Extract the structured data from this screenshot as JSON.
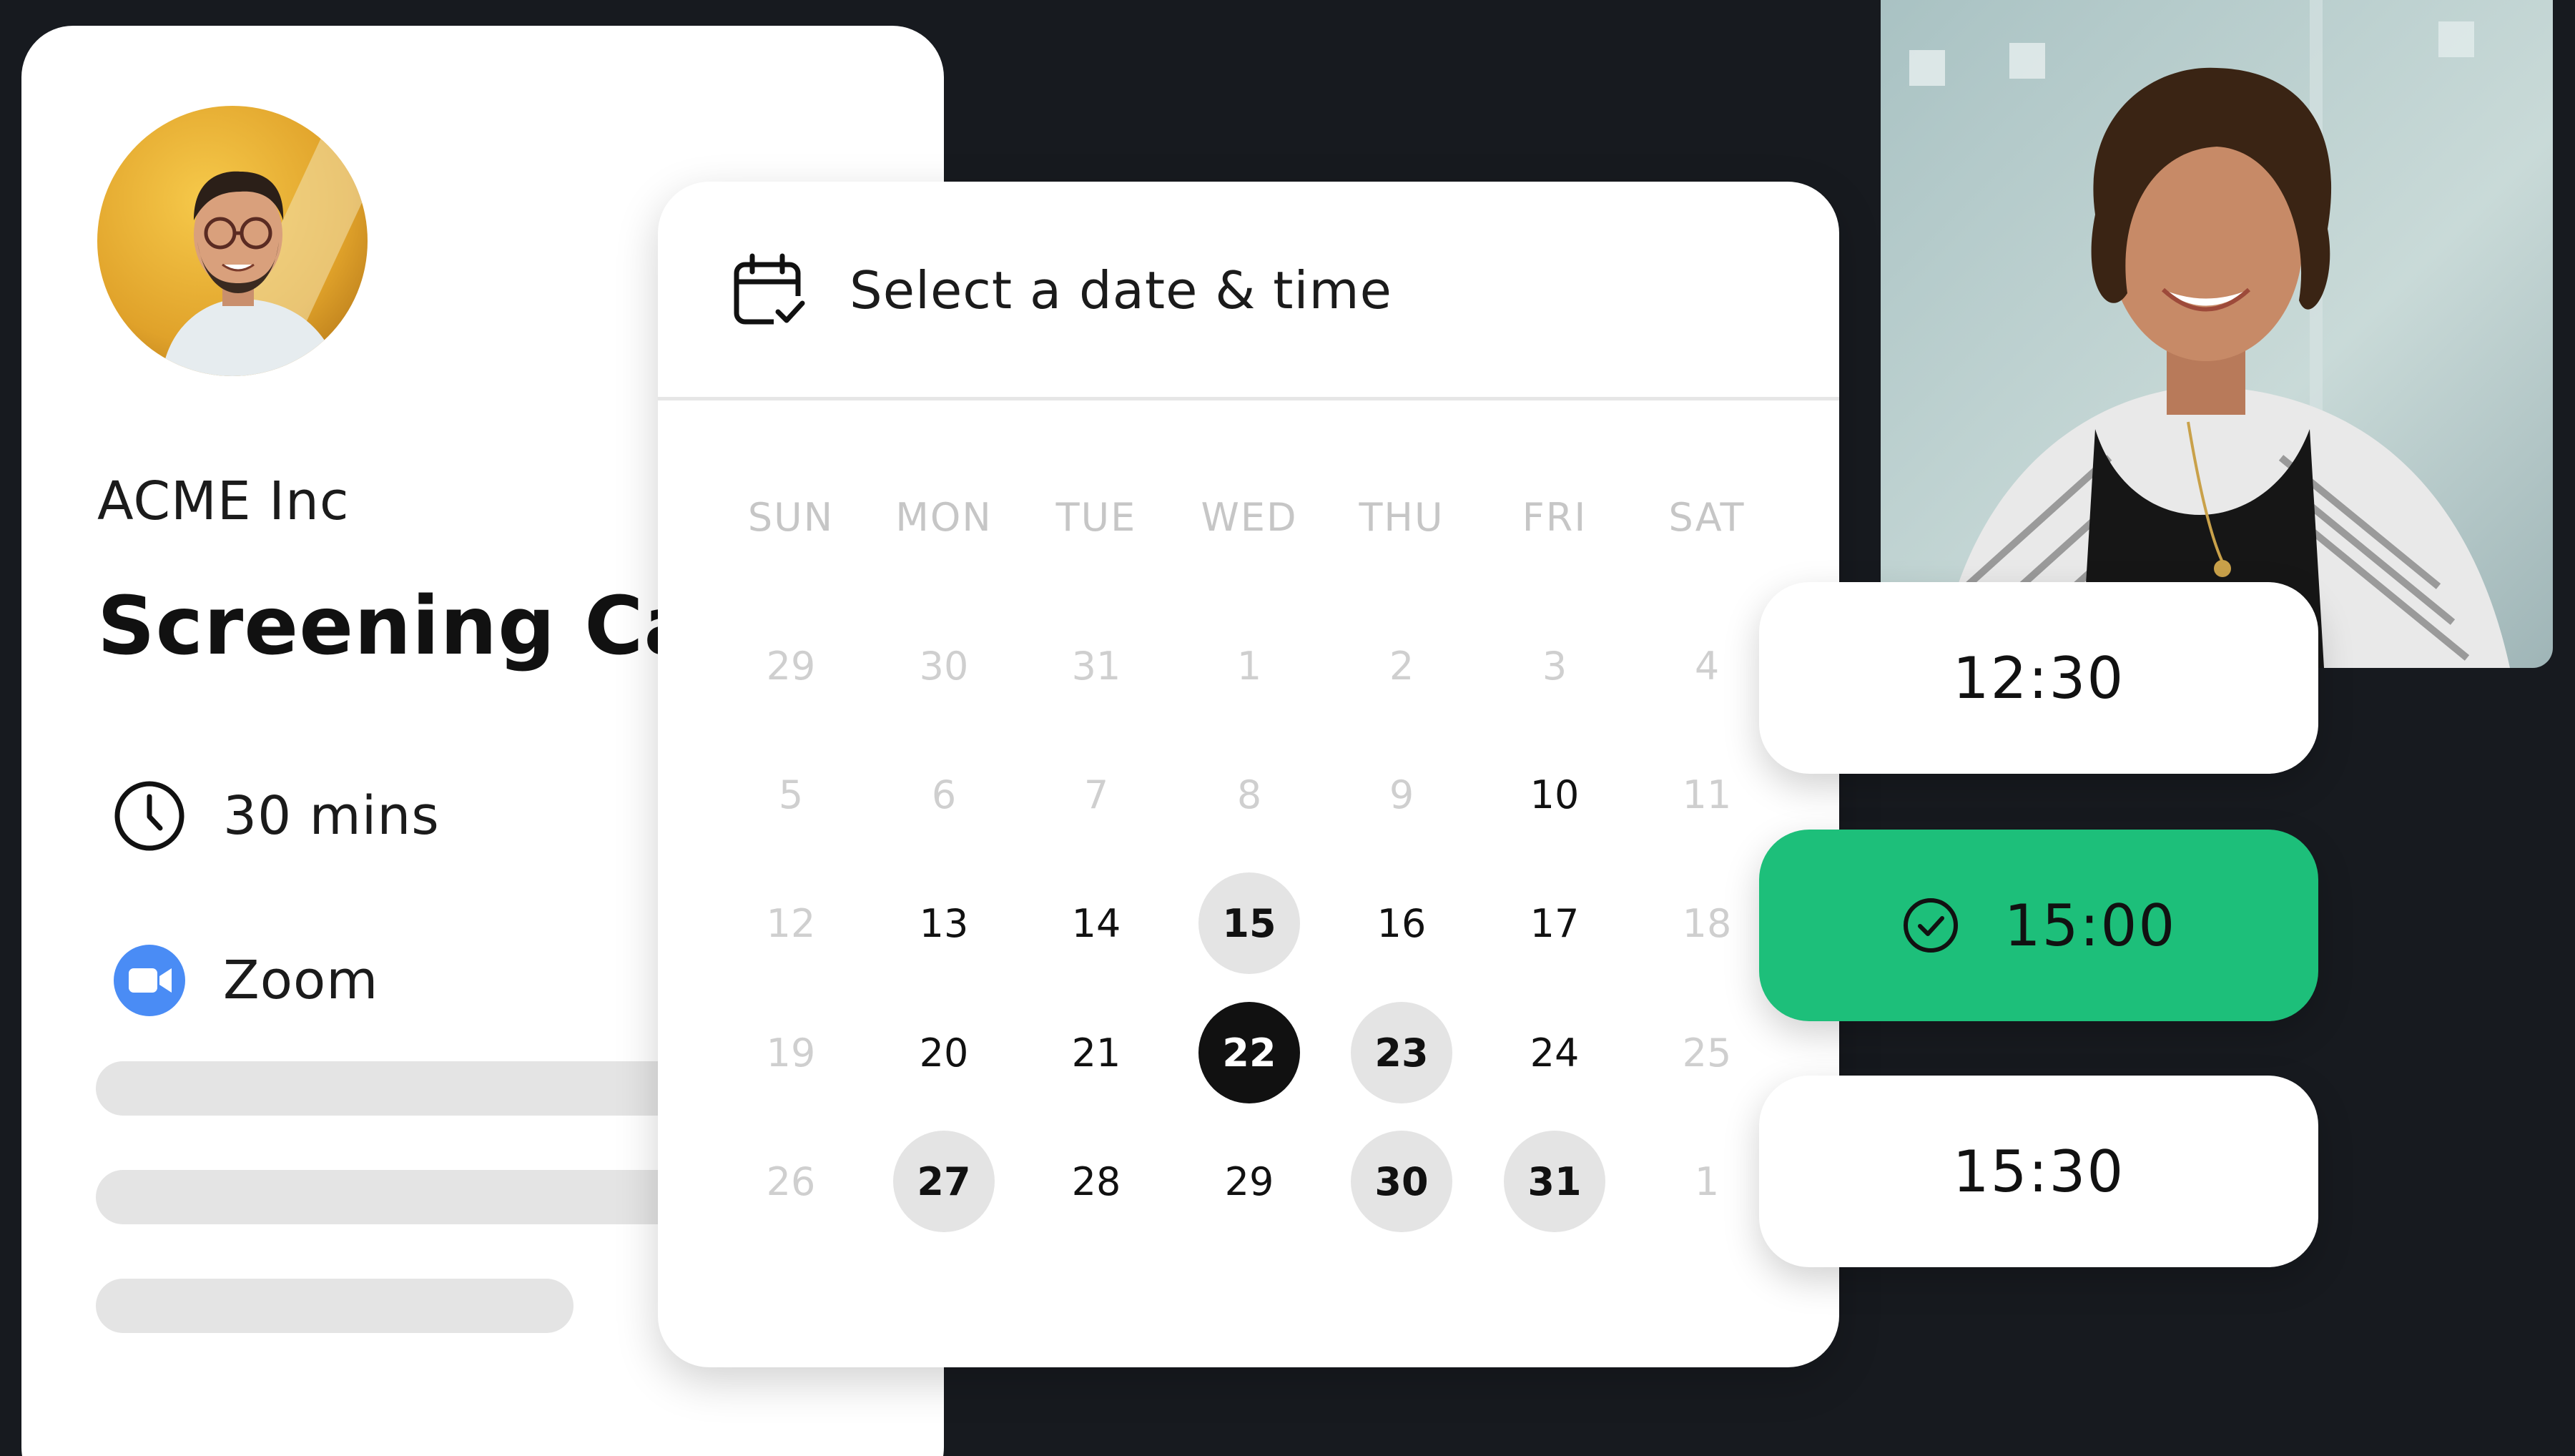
{
  "event": {
    "company": "ACME Inc",
    "title": "Screening Call",
    "duration": "30 mins",
    "location": "Zoom",
    "icons": {
      "duration": "clock-icon",
      "location": "zoom-video-icon"
    },
    "zoom_color": "#4a8cf5"
  },
  "calendar": {
    "title": "Select a date & time",
    "icon": "calendar-check-icon",
    "weekdays": [
      "SUN",
      "MON",
      "TUE",
      "WED",
      "THU",
      "FRI",
      "SAT"
    ],
    "weeks": [
      [
        {
          "d": "29",
          "s": "muted"
        },
        {
          "d": "30",
          "s": "muted"
        },
        {
          "d": "31",
          "s": "muted"
        },
        {
          "d": "1",
          "s": "muted"
        },
        {
          "d": "2",
          "s": "muted"
        },
        {
          "d": "3",
          "s": "muted"
        },
        {
          "d": "4",
          "s": "muted"
        }
      ],
      [
        {
          "d": "5",
          "s": "muted"
        },
        {
          "d": "6",
          "s": "muted"
        },
        {
          "d": "7",
          "s": "muted"
        },
        {
          "d": "8",
          "s": "muted"
        },
        {
          "d": "9",
          "s": "muted"
        },
        {
          "d": "10",
          "s": "normal"
        },
        {
          "d": "11",
          "s": "muted"
        }
      ],
      [
        {
          "d": "12",
          "s": "muted"
        },
        {
          "d": "13",
          "s": "normal"
        },
        {
          "d": "14",
          "s": "normal"
        },
        {
          "d": "15",
          "s": "available"
        },
        {
          "d": "16",
          "s": "normal"
        },
        {
          "d": "17",
          "s": "normal"
        },
        {
          "d": "18",
          "s": "muted"
        }
      ],
      [
        {
          "d": "19",
          "s": "muted"
        },
        {
          "d": "20",
          "s": "normal"
        },
        {
          "d": "21",
          "s": "normal"
        },
        {
          "d": "22",
          "s": "selected"
        },
        {
          "d": "23",
          "s": "available"
        },
        {
          "d": "24",
          "s": "normal"
        },
        {
          "d": "25",
          "s": "muted"
        }
      ],
      [
        {
          "d": "26",
          "s": "muted"
        },
        {
          "d": "27",
          "s": "available"
        },
        {
          "d": "28",
          "s": "normal"
        },
        {
          "d": "29",
          "s": "normal"
        },
        {
          "d": "30",
          "s": "available"
        },
        {
          "d": "31",
          "s": "available"
        },
        {
          "d": "1",
          "s": "muted"
        }
      ]
    ]
  },
  "time_slots": [
    {
      "time": "12:30",
      "selected": false
    },
    {
      "time": "15:00",
      "selected": true
    },
    {
      "time": "15:30",
      "selected": false
    }
  ],
  "colors": {
    "background": "#171a1f",
    "accent_green": "#1dbf7a",
    "selected_day": "#111111",
    "available_day": "#e4e4e4",
    "muted_text": "#cfcfcf"
  }
}
